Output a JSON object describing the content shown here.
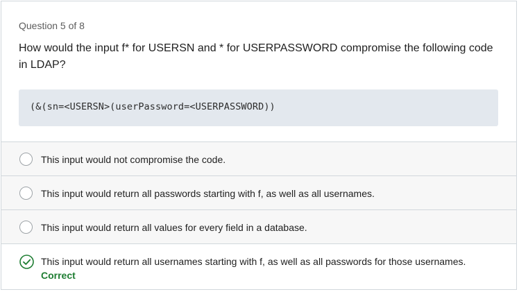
{
  "quiz": {
    "counter": "Question 5 of 8",
    "question": "How would the input f* for USERSN and * for USERPASSWORD compromise the following code in LDAP?",
    "code": "(&(sn=<USERSN>(userPassword=<USERPASSWORD))",
    "answers": [
      {
        "text": "This input would not compromise the code.",
        "state": "unselected"
      },
      {
        "text": "This input would return all passwords starting with f, as well as all usernames.",
        "state": "unselected"
      },
      {
        "text": "This input would return all values for every field in a database.",
        "state": "unselected"
      },
      {
        "text": "This input would return all usernames starting with f, as well as all passwords for those usernames.",
        "state": "selected-correct",
        "verdict": "Correct"
      }
    ],
    "icons": {
      "unselected": "radio-empty-icon",
      "correct": "check-circle-icon"
    },
    "colors": {
      "correct": "#1e7d32",
      "code_bg": "#e3e8ee",
      "answer_bg": "#f7f7f7",
      "border": "#d1d7dc"
    }
  }
}
